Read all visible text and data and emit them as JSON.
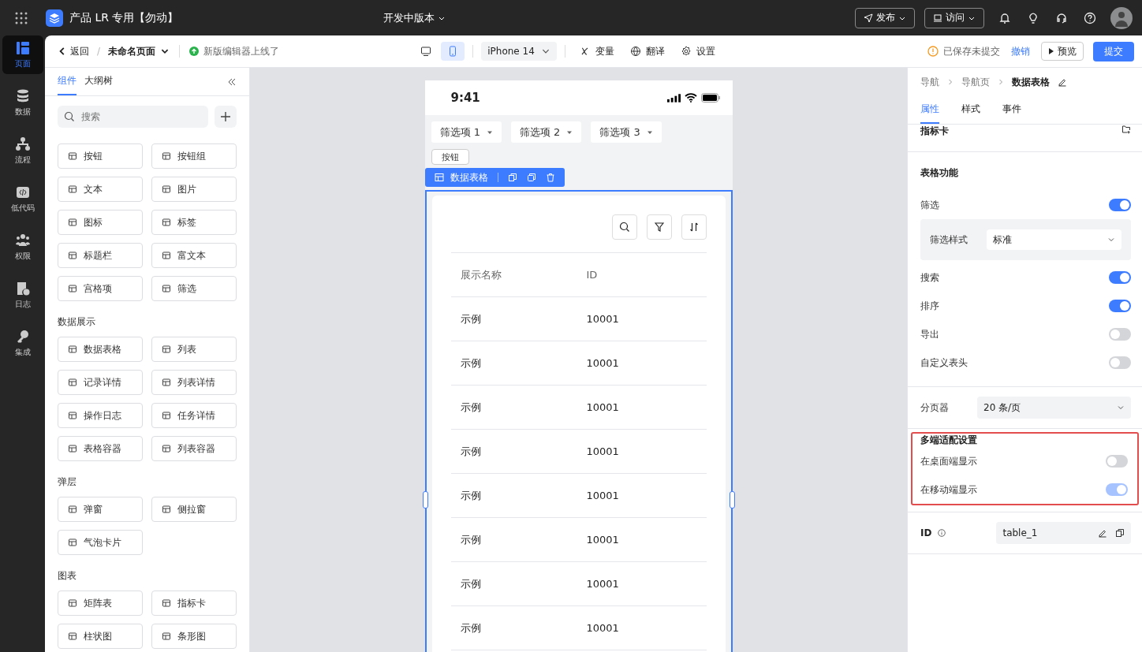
{
  "top_bar": {
    "app_name": "产品 LR 专用【勿动】",
    "version": "开发中版本",
    "buttons": [
      {
        "kind": "publish",
        "label": "发布"
      },
      {
        "kind": "visit",
        "label": "访问"
      }
    ]
  },
  "rail": {
    "items": [
      {
        "kind": "page",
        "label": "页面",
        "selected": true
      },
      {
        "kind": "data",
        "label": "数据",
        "selected": false
      },
      {
        "kind": "flow",
        "label": "流程",
        "selected": false
      },
      {
        "kind": "code",
        "label": "低代码",
        "selected": false
      },
      {
        "kind": "perm",
        "label": "权限",
        "selected": false
      },
      {
        "kind": "log",
        "label": "日志",
        "selected": false
      },
      {
        "kind": "integration",
        "label": "集成",
        "selected": false
      }
    ]
  },
  "toolbar": {
    "back": "返回",
    "separator": "/",
    "page_name": "未命名页面",
    "notice": "新版编辑器上线了",
    "devices": [
      {
        "kind": "desktop",
        "selected": false
      },
      {
        "kind": "mobile",
        "selected": true
      }
    ],
    "device_select": "iPhone 14",
    "actions": [
      {
        "kind": "variable",
        "label": "变量"
      },
      {
        "kind": "translate",
        "label": "翻译"
      },
      {
        "kind": "settings",
        "label": "设置"
      }
    ],
    "save_status": "已保存未提交",
    "undo": "撤销",
    "preview": "预览",
    "submit": "提交"
  },
  "left_panel": {
    "tabs": [
      {
        "label": "组件",
        "selected": true
      },
      {
        "label": "大纲树",
        "selected": false
      }
    ],
    "search": {
      "placeholder": "搜索"
    },
    "groups": [
      {
        "items": [
          "按钮",
          "按钮组",
          "文本",
          "图片",
          "图标",
          "标签",
          "标题栏",
          "富文本",
          "宫格项",
          "筛选"
        ]
      },
      {
        "title": "数据展示",
        "items": [
          "数据表格",
          "列表",
          "记录详情",
          "列表详情",
          "操作日志",
          "任务详情",
          "表格容器",
          "列表容器"
        ]
      },
      {
        "title": "弹层",
        "items": [
          "弹窗",
          "侧拉窗",
          "气泡卡片"
        ]
      },
      {
        "title": "图表",
        "items": [
          "矩阵表",
          "指标卡",
          "柱状图",
          "条形图"
        ]
      }
    ]
  },
  "phone": {
    "time": "9:41",
    "filters": [
      "筛选项 1",
      "筛选项 2",
      "筛选项 3"
    ],
    "button": "按钮",
    "selection_label": "数据表格",
    "table": {
      "columns": [
        "展示名称",
        "ID"
      ],
      "rows": [
        [
          "示例",
          "10001"
        ],
        [
          "示例",
          "10001"
        ],
        [
          "示例",
          "10001"
        ],
        [
          "示例",
          "10001"
        ],
        [
          "示例",
          "10001"
        ],
        [
          "示例",
          "10001"
        ],
        [
          "示例",
          "10001"
        ],
        [
          "示例",
          "10001"
        ]
      ]
    }
  },
  "right_panel": {
    "breadcrumb": [
      "导航",
      "导航页",
      "数据表格"
    ],
    "tabs": [
      {
        "label": "属性",
        "selected": true
      },
      {
        "label": "样式",
        "selected": false
      },
      {
        "label": "事件",
        "selected": false
      }
    ],
    "top_section": "指标卡",
    "features_title": "表格功能",
    "settings": [
      {
        "kind": "toggle",
        "label": "筛选",
        "on": true
      },
      {
        "kind": "select",
        "label": "筛选样式",
        "value": "标准"
      },
      {
        "kind": "toggle",
        "label": "搜索",
        "on": true
      },
      {
        "kind": "toggle",
        "label": "排序",
        "on": true
      },
      {
        "kind": "toggle",
        "label": "导出",
        "on": false
      },
      {
        "kind": "toggle",
        "label": "自定义表头",
        "on": false
      }
    ],
    "pagination": {
      "label": "分页器",
      "value": "20 条/页"
    },
    "adaptive": {
      "title": "多端适配设置",
      "toggles": [
        {
          "label": "在桌面端显示",
          "on": false,
          "disabled": false
        },
        {
          "label": "在移动端显示",
          "on": true,
          "disabled": true
        }
      ]
    },
    "id": {
      "label": "ID",
      "value": "table_1"
    }
  }
}
